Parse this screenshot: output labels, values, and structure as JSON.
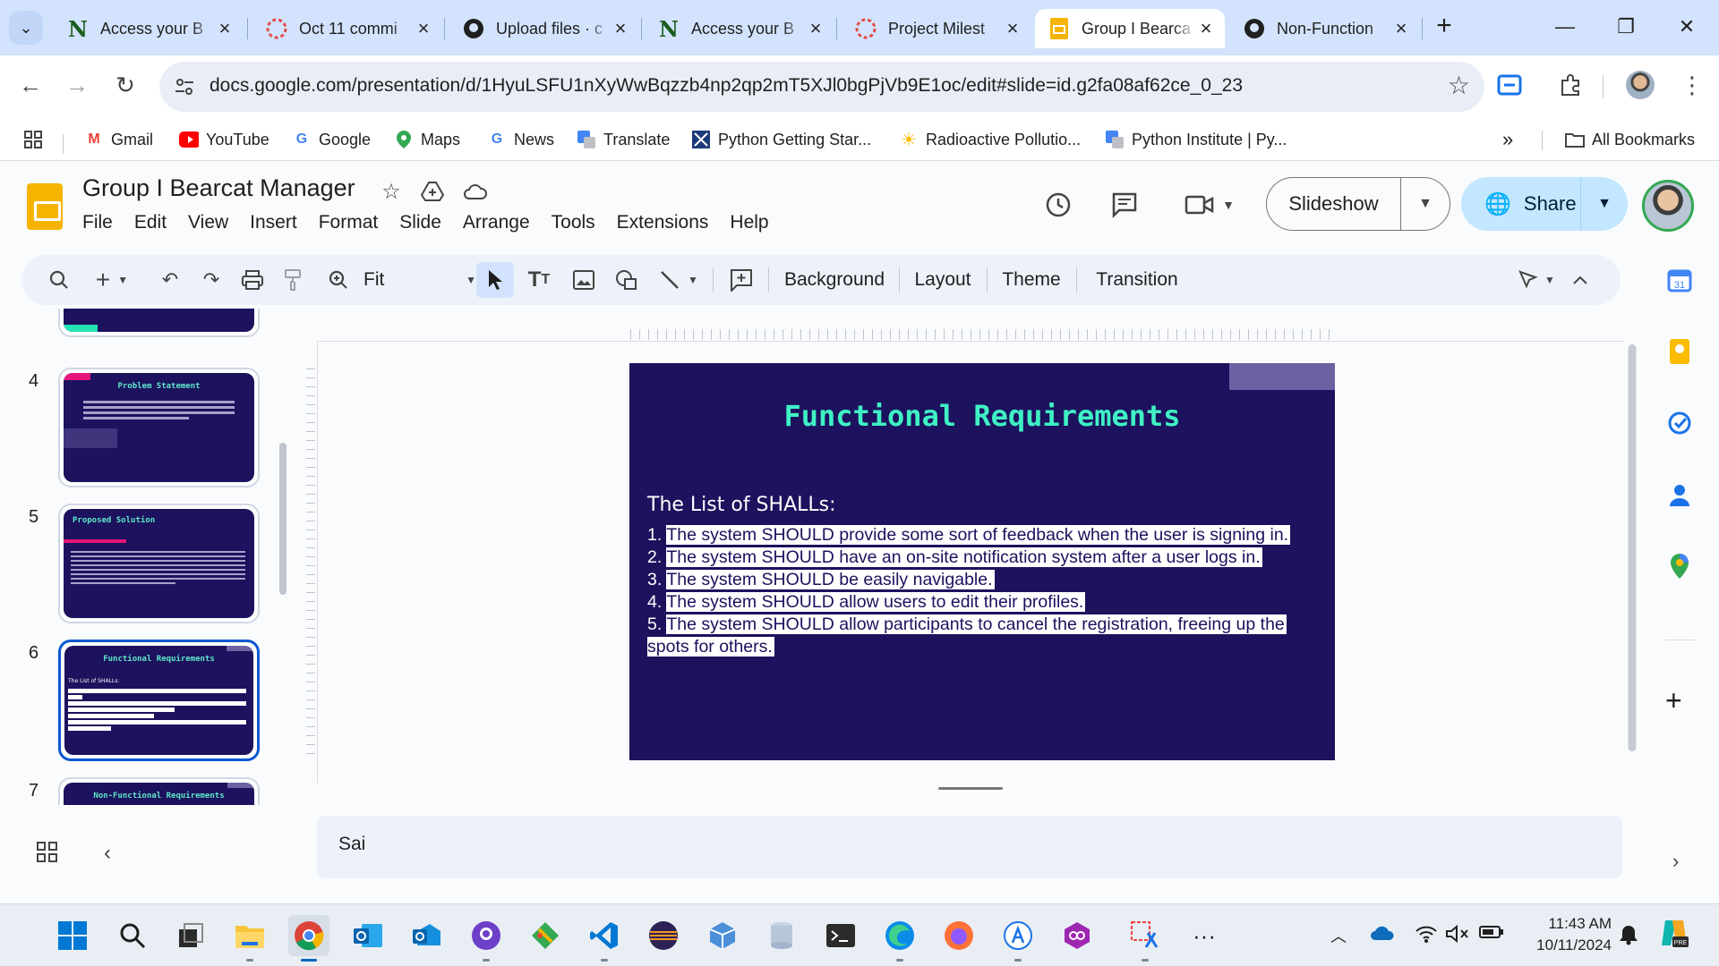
{
  "browser": {
    "tabs": [
      {
        "title": "Access your B",
        "icon": "notion-n-icon"
      },
      {
        "title": "Oct 11 commi",
        "icon": "asana-dots-icon"
      },
      {
        "title": "Upload files · c",
        "icon": "github-icon"
      },
      {
        "title": "Access your B",
        "icon": "notion-n-icon"
      },
      {
        "title": "Project Milest",
        "icon": "asana-dots-icon"
      },
      {
        "title": "Group I Bearca",
        "icon": "google-slides-icon",
        "active": true
      },
      {
        "title": "Non-Function",
        "icon": "github-icon"
      }
    ],
    "url": "docs.google.com/presentation/d/1HyuLSFU1nXyWwBqzzb4np2qp2mT5XJl0bgPjVb9E1oc/edit#slide=id.g2fa08af62ce_0_23",
    "bookmarks": [
      {
        "label": "Gmail",
        "icon": "gmail-icon"
      },
      {
        "label": "YouTube",
        "icon": "youtube-icon"
      },
      {
        "label": "Google",
        "icon": "google-g-icon"
      },
      {
        "label": "Maps",
        "icon": "maps-icon"
      },
      {
        "label": "News",
        "icon": "google-news-icon"
      },
      {
        "label": "Translate",
        "icon": "translate-icon"
      },
      {
        "label": "Python Getting Star...",
        "icon": "python-icon"
      },
      {
        "label": "Radioactive Pollutio...",
        "icon": "sun-icon"
      },
      {
        "label": "Python Institute | Py...",
        "icon": "translate-icon"
      }
    ],
    "all_bookmarks": "All Bookmarks"
  },
  "doc": {
    "title": "Group I Bearcat Manager",
    "menu": [
      "File",
      "Edit",
      "View",
      "Insert",
      "Format",
      "Slide",
      "Arrange",
      "Tools",
      "Extensions",
      "Help"
    ],
    "slideshow_label": "Slideshow",
    "share_label": "Share"
  },
  "toolbar": {
    "zoom": "Fit",
    "background": "Background",
    "layout": "Layout",
    "theme": "Theme",
    "transition": "Transition"
  },
  "filmstrip": {
    "slides": [
      {
        "num": "4",
        "title": "Problem Statement"
      },
      {
        "num": "5",
        "title": "Proposed Solution"
      },
      {
        "num": "6",
        "title": "Functional Requirements",
        "selected": true
      },
      {
        "num": "7",
        "title": "Non-Functional Requirements"
      }
    ]
  },
  "slide": {
    "title": "Functional Requirements",
    "subtitle": "The List of SHALLs:",
    "requirements": [
      {
        "num": "1.",
        "text": "The system SHOULD provide some sort of feedback when the user is signing in."
      },
      {
        "num": "2.",
        "text": "The system SHOULD have an on-site notification system after a user logs in."
      },
      {
        "num": "3.",
        "text": "The system SHOULD be easily navigable."
      },
      {
        "num": "4.",
        "text": "The system SHOULD allow users to edit their profiles."
      },
      {
        "num": "5.",
        "text": "The system SHOULD allow participants to cancel the registration, freeing up the spots for others."
      }
    ],
    "colors": {
      "background": "#1c125e",
      "title": "#3ff2c4",
      "accent": "#6b62a3"
    }
  },
  "notes": {
    "text": "Sai"
  },
  "taskbar": {
    "apps": [
      "windows-start-icon",
      "search-icon",
      "task-view-icon",
      "file-explorer-icon",
      "chrome-icon",
      "outlook-icon",
      "outlook-new-icon",
      "github-desktop-icon",
      "git-icon",
      "vscode-icon",
      "eclipse-icon",
      "cube-icon",
      "database-icon",
      "terminal-icon",
      "edge-icon",
      "firefox-icon",
      "app-store-icon",
      "coda-icon",
      "snipping-tool-icon",
      "more-icon"
    ],
    "time": "11:43 AM",
    "date": "10/11/2024"
  }
}
